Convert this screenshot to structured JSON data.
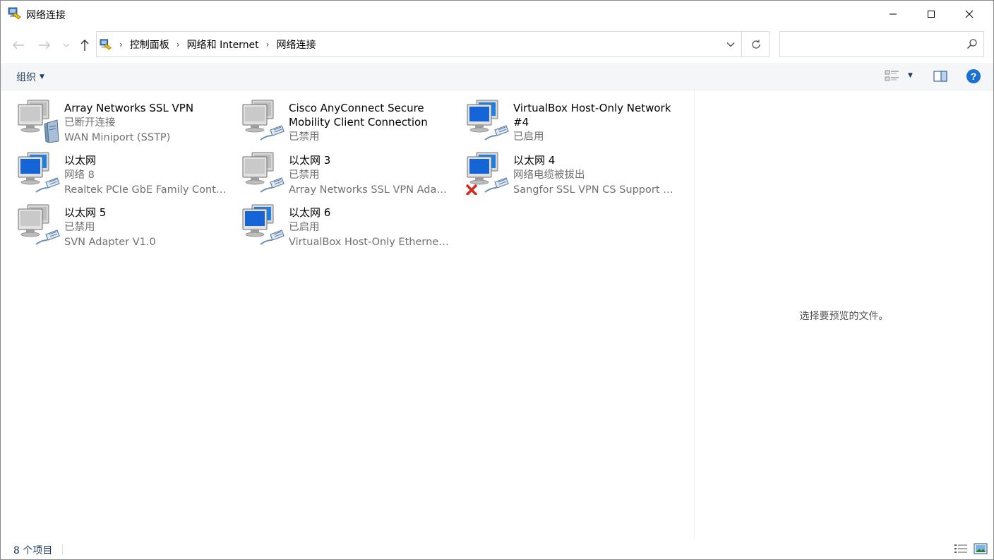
{
  "window": {
    "title": "网络连接",
    "icon": "network-connections-icon"
  },
  "address": {
    "crumbs": [
      "控制面板",
      "网络和 Internet",
      "网络连接"
    ],
    "search_placeholder": ""
  },
  "toolbar": {
    "organize_label": "组织"
  },
  "items": [
    {
      "name": "Array Networks SSL VPN",
      "status": "已断开连接",
      "device": "WAN Miniport (SSTP)",
      "icon": "vpn-connection-icon",
      "state": "disconnected"
    },
    {
      "name": "Cisco AnyConnect Secure Mobility Client Connection",
      "status": "已禁用",
      "device": "",
      "icon": "network-adapter-icon",
      "state": "disabled"
    },
    {
      "name": "VirtualBox Host-Only Network #4",
      "status": "已启用",
      "device": "",
      "icon": "network-adapter-icon",
      "state": "enabled"
    },
    {
      "name": "以太网",
      "status": "网络 8",
      "device": "Realtek PCIe GbE Family Contr...",
      "icon": "network-adapter-icon",
      "state": "enabled"
    },
    {
      "name": "以太网 3",
      "status": "已禁用",
      "device": "Array Networks SSL VPN Adap...",
      "icon": "network-adapter-icon",
      "state": "disabled"
    },
    {
      "name": "以太网 4",
      "status": "网络电缆被拔出",
      "device": "Sangfor SSL VPN CS Support S...",
      "icon": "network-adapter-icon",
      "state": "unplugged"
    },
    {
      "name": "以太网 5",
      "status": "已禁用",
      "device": "SVN Adapter V1.0",
      "icon": "network-adapter-icon",
      "state": "disabled"
    },
    {
      "name": "以太网 6",
      "status": "已启用",
      "device": "VirtualBox Host-Only Ethernet ...",
      "icon": "network-adapter-icon",
      "state": "enabled"
    }
  ],
  "preview": {
    "text": "选择要预览的文件。"
  },
  "status": {
    "count_text": "8 个项目"
  },
  "colors": {
    "link_text": "#1e3d5c",
    "secondary_text": "#707070",
    "help_blue": "#1a6fd1",
    "error_red": "#d9261c"
  }
}
